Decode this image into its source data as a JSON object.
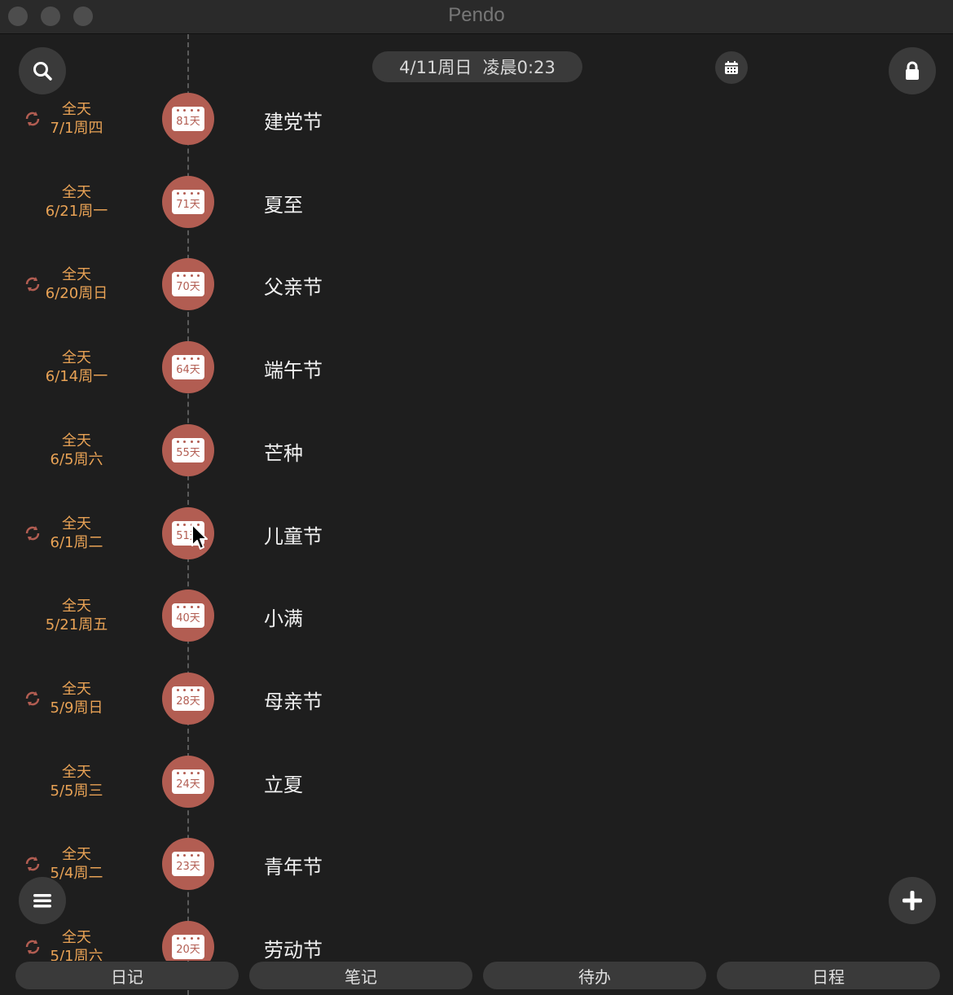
{
  "window": {
    "title": "Pendo"
  },
  "header": {
    "current_datetime": "4/11周日  凌晨0:23",
    "search_icon": "search-icon",
    "calendar_icon": "calendar-icon",
    "lock_icon": "lock-icon"
  },
  "events": [
    {
      "time": "全天",
      "date": "7/1周四",
      "days": "81天",
      "name": "建党节",
      "repeat": true
    },
    {
      "time": "全天",
      "date": "6/21周一",
      "days": "71天",
      "name": "夏至",
      "repeat": false
    },
    {
      "time": "全天",
      "date": "6/20周日",
      "days": "70天",
      "name": "父亲节",
      "repeat": true
    },
    {
      "time": "全天",
      "date": "6/14周一",
      "days": "64天",
      "name": "端午节",
      "repeat": false
    },
    {
      "time": "全天",
      "date": "6/5周六",
      "days": "55天",
      "name": "芒种",
      "repeat": false
    },
    {
      "time": "全天",
      "date": "6/1周二",
      "days": "51天",
      "name": "儿童节",
      "repeat": true
    },
    {
      "time": "全天",
      "date": "5/21周五",
      "days": "40天",
      "name": "小满",
      "repeat": false
    },
    {
      "time": "全天",
      "date": "5/9周日",
      "days": "28天",
      "name": "母亲节",
      "repeat": true
    },
    {
      "time": "全天",
      "date": "5/5周三",
      "days": "24天",
      "name": "立夏",
      "repeat": false
    },
    {
      "time": "全天",
      "date": "5/4周二",
      "days": "23天",
      "name": "青年节",
      "repeat": true
    },
    {
      "time": "全天",
      "date": "5/1周六",
      "days": "20天",
      "name": "劳动节",
      "repeat": true
    }
  ],
  "tabs": {
    "diary": "日记",
    "note": "笔记",
    "todo": "待办",
    "schedule": "日程"
  },
  "colors": {
    "accent": "#b25d52",
    "time_text": "#e8a255",
    "background": "#1e1e1e"
  }
}
